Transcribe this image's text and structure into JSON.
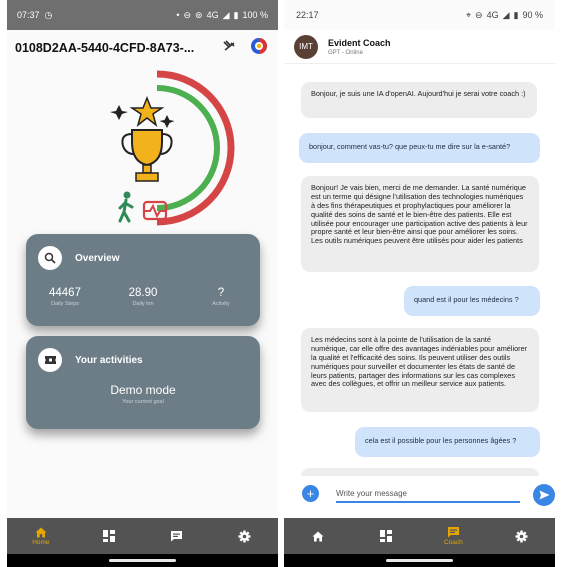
{
  "left": {
    "status": {
      "time": "07:37",
      "signal": "4G",
      "battery": "100 %"
    },
    "header": {
      "title": "0108D2AA-5440-4CFD-8A73-..."
    },
    "overview": {
      "title": "Overview",
      "stats": [
        {
          "value": "44467",
          "label": "Daily Steps"
        },
        {
          "value": "28.90",
          "label": "Daily km"
        },
        {
          "value": "?",
          "label": "Activity"
        }
      ]
    },
    "activities": {
      "title": "Your activities",
      "mode": "Demo mode",
      "subtitle": "Your current goal"
    },
    "nav": [
      {
        "icon": "home-icon",
        "label": "Home",
        "active": true
      },
      {
        "icon": "dashboard-icon",
        "label": "",
        "active": false
      },
      {
        "icon": "chat-icon",
        "label": "",
        "active": false
      },
      {
        "icon": "settings-icon",
        "label": "",
        "active": false
      }
    ]
  },
  "right": {
    "status": {
      "time": "22:17",
      "signal": "4G",
      "battery": "90 %"
    },
    "header": {
      "avatar_text": "IMT",
      "name": "Evident Coach",
      "status": "GPT - Online"
    },
    "messages": [
      {
        "from": "bot",
        "text": "Bonjour, je suis une IA d'openAI. Aujourd'hui je serai votre coach :)"
      },
      {
        "from": "user",
        "text": "bonjour, comment vas-tu? que peux-tu me dire sur la e-santé?"
      },
      {
        "from": "bot",
        "text": "Bonjour! Je vais bien, merci de me demander. La santé numérique est un terme qui désigne l'utilisation des technologies numériques à des fins thérapeutiques et prophylactiques pour améliorer la qualité des soins de santé et le bien-être des patients. Elle est utilisée pour encourager une participation active des patients à leur propre santé et leur bien-être ainsi que pour améliorer les soins. Les outils numériques peuvent être utilisés pour aider les patients"
      },
      {
        "from": "user",
        "text": "quand est il pour les médecins ?"
      },
      {
        "from": "bot",
        "text": "Les médecins sont à la pointe de l'utilisation de la santé numérique, car elle offre des avantages indéniables pour améliorer la qualité et l'efficacité des soins. Ils peuvent utiliser des outils numériques pour surveiller et documenter les états de santé de leurs patients, partager des informations sur les cas complexes avec des collègues, et offrir un meilleur service aux patients."
      },
      {
        "from": "user",
        "text": "cela est il possible pour les personnes âgées ?"
      }
    ],
    "input": {
      "placeholder": "Write your message"
    },
    "nav": [
      {
        "icon": "home-icon",
        "label": "",
        "active": false
      },
      {
        "icon": "dashboard-icon",
        "label": "",
        "active": false
      },
      {
        "icon": "chat-icon",
        "label": "Coach",
        "active": true
      },
      {
        "icon": "settings-icon",
        "label": "",
        "active": false
      }
    ]
  },
  "colors": {
    "card_bg": "#6d7d87",
    "nav_bg": "#535353",
    "nav_active": "#e5a400",
    "accent_blue": "#3a86e5",
    "bot_bubble": "#ededed",
    "user_bubble": "#cfe3fb",
    "arc_red": "#d64545",
    "arc_green": "#4caf50"
  }
}
